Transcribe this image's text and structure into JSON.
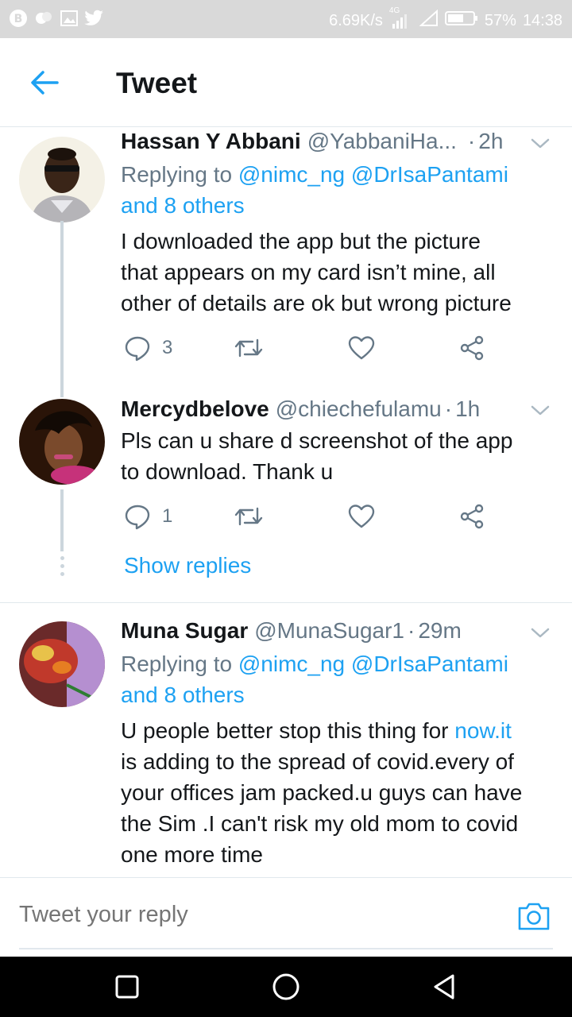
{
  "status_bar": {
    "speed": "6.69K/s",
    "network": "4G",
    "battery": "57%",
    "time": "14:38"
  },
  "header": {
    "title": "Tweet"
  },
  "tweets": [
    {
      "name": "Hassan Y Abbani",
      "handle": "@YabbaniHa...",
      "time": "2h",
      "replying_prefix": "Replying to",
      "replying_mentions": "@nimc_ng @DrIsaPantami",
      "replying_others": "and 8 others",
      "text_lines": [
        "I downloaded the app but the picture",
        "that appears on my card isn’t mine, all",
        "other of details are ok but wrong picture"
      ],
      "reply_count": "3"
    },
    {
      "name": "Mercydbelove",
      "handle": "@chiechefulamu",
      "time": "1h",
      "text_lines": [
        "Pls can u share d screenshot of the app",
        "to download. Thank u"
      ],
      "reply_count": "1",
      "show_replies": "Show replies"
    },
    {
      "name": "Muna Sugar",
      "handle": "@MunaSugar1",
      "time": "29m",
      "replying_prefix": "Replying to",
      "replying_mentions": "@nimc_ng @DrIsaPantami",
      "replying_others": "and 8 others",
      "text_line1_prefix": "U people better stop this thing for",
      "text_line1_link": "now.it",
      "text_lines_rest": [
        "is adding to the spread of covid.every of",
        "your offices jam packed.u guys can have",
        "the Sim .I can't risk my old mom to covid",
        "one more time"
      ]
    }
  ],
  "composer": {
    "placeholder": "Tweet your reply"
  },
  "icons": {
    "back": "arrow-left-icon",
    "reply": "reply-icon",
    "retweet": "retweet-icon",
    "like": "heart-icon",
    "share": "share-icon",
    "camera": "camera-icon"
  },
  "colors": {
    "accent": "#1da1f2",
    "text": "#14171a",
    "secondary": "#657786",
    "divider": "#e1e8ed"
  }
}
